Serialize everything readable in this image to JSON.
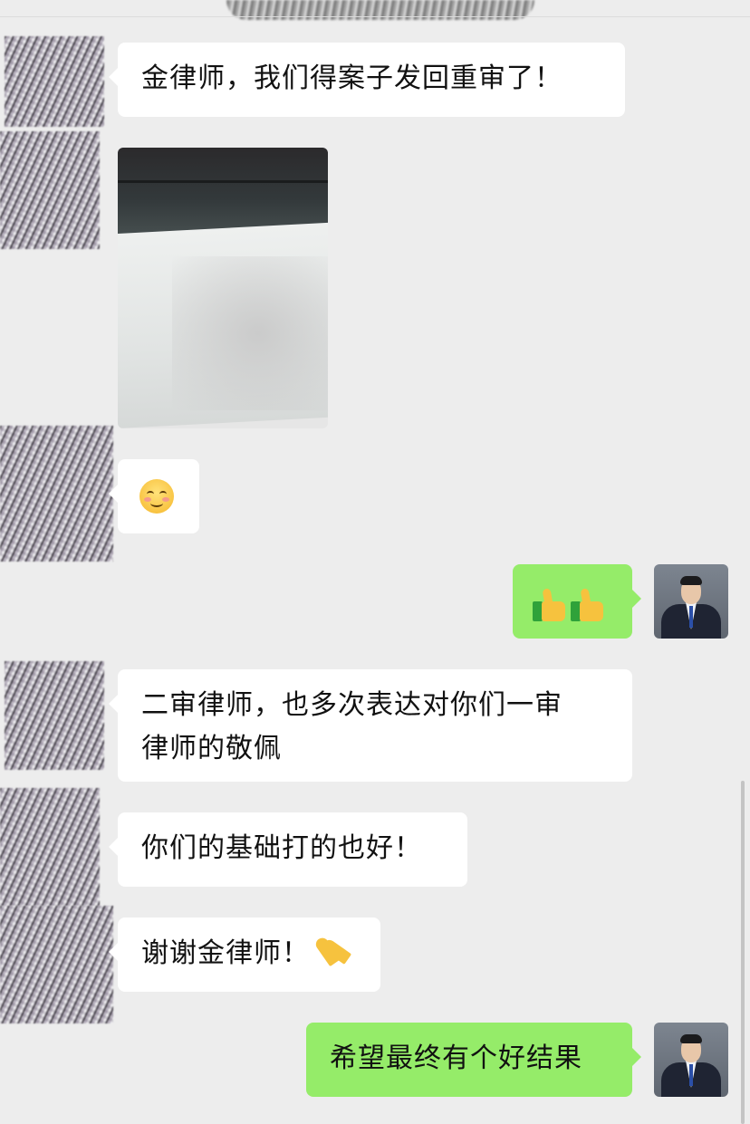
{
  "messages": [
    {
      "sender": "other",
      "type": "text",
      "text": "金律师，我们得案子发回重审了！"
    },
    {
      "sender": "other",
      "type": "image"
    },
    {
      "sender": "other",
      "type": "emoji",
      "icon": "smiling-face-icon"
    },
    {
      "sender": "me",
      "type": "emoji",
      "icon": "thumbs-up-icon",
      "count": 2
    },
    {
      "sender": "other",
      "type": "text",
      "line1": "二审律师，也多次表达对你们一审",
      "line2": "律师的敬佩"
    },
    {
      "sender": "other",
      "type": "text",
      "text": "你们的基础打的也好！"
    },
    {
      "sender": "other",
      "type": "text",
      "text": "谢谢金律师！",
      "trailing_icon": "folded-hands-icon"
    },
    {
      "sender": "me",
      "type": "text",
      "text": "希望最终有个好结果"
    }
  ],
  "colors": {
    "background": "#ededed",
    "incoming_bubble": "#ffffff",
    "outgoing_bubble": "#95ec69"
  }
}
